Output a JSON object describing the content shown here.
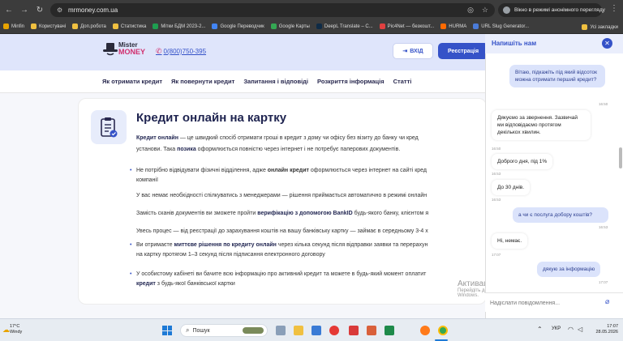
{
  "browser": {
    "url": "mrmoney.com.ua",
    "incognito_label": "Вікно в режимі анонімного перегляду",
    "bookmarks": [
      {
        "label": "Minfin",
        "color": "#e8a400"
      },
      {
        "label": "Користувачі",
        "color": "#f0c040"
      },
      {
        "label": "Доп.робота",
        "color": "#f0c040"
      },
      {
        "label": "Статистика",
        "color": "#f0c040"
      },
      {
        "label": "Мітки БДМ 2023-2...",
        "color": "#1e9e50"
      },
      {
        "label": "Google Переводчик",
        "color": "#4285f4"
      },
      {
        "label": "Google Карты",
        "color": "#34a853"
      },
      {
        "label": "DeepL Translate – С...",
        "color": "#0f2b46"
      },
      {
        "label": "Pic4Net — безкошт...",
        "color": "#e04040"
      },
      {
        "label": "HURMA",
        "color": "#ff6a00"
      },
      {
        "label": "URL Slug Generator...",
        "color": "#4a7bd8"
      }
    ],
    "all_bookmarks": "Усі закладки"
  },
  "site": {
    "logo_top": "Mister",
    "logo_bottom": "MONEY",
    "phone": "0(800)750-395",
    "login": "ВХІД",
    "register": "Реєстрація",
    "nav": [
      "Як отримати кредит",
      "Як повернути кредит",
      "Запитання і відповіді",
      "Розкриття інформація",
      "Статті"
    ]
  },
  "article": {
    "title": "Кредит онлайн на картку",
    "intro_bold": "Кредит онлайн",
    "intro_text": " — це швидкий спосіб отримати гроші в кредит з дому чи офісу без візиту до банку чи кред",
    "intro_line2_a": "установи. Така ",
    "intro_line2_bold": "позика",
    "intro_line2_b": " оформлюється повністю через інтернет і не потребує паперових документів.",
    "bullets": [
      {
        "a": "Не потрібно відвідувати фізичні відділення, адже ",
        "b": "онлайн кредит",
        "c": " оформлюється через інтернет на сайті кред",
        "d": "компанії"
      },
      {
        "a": "У вас немає необхідності спілкуватись з менеджерами — рішення приймається автоматично в режимі онлайн",
        "b": "",
        "c": "",
        "d": ""
      },
      {
        "a": "Замість сканів документів ви зможете пройти ",
        "b": "верифікацію з допомогою BankID",
        "c": " будь-якого банку, клієнтом я",
        "d": ""
      },
      {
        "a": "Увесь процес — від реєстрації до зарахування коштів на вашу банківську картку — займає в середньому 3-4 х",
        "b": "",
        "c": "",
        "d": ""
      },
      {
        "a": "Ви отримаєте ",
        "b": "миттєве рішення по кредиту онлайн",
        "c": " через кілька секунд після відправки заявки та перерахун",
        "d": "на картку протягом 1–3 секунд після підписання електронного договору"
      },
      {
        "a": "У особистому кабінеті ви бачите всю інформацію про активний кредит та можете в будь-який момент оплатит",
        "b": "",
        "c": "",
        "d": "",
        "e_bold": "кредит",
        "e": " з будь-якої банківської картки"
      }
    ]
  },
  "chat": {
    "title": "Напишіть нам",
    "messages": [
      {
        "from": "me",
        "text": "Вітаю, підкажіть під який відсоток можна отримати перший кредит?",
        "time": "16:50"
      },
      {
        "from": "them",
        "text": "Дякуємо за звернення. Зазвичай ми відповідаємо протягом декількох хвилин.",
        "time": "16:50"
      },
      {
        "from": "them",
        "text": "Доброго дня, під 1%",
        "time": "16:53"
      },
      {
        "from": "them",
        "text": "До 30 днів.",
        "time": "16:53"
      },
      {
        "from": "me",
        "text": "а чи є послуга добору коштів?",
        "time": "16:53"
      },
      {
        "from": "them",
        "text": "Ні, немає.",
        "time": "17:07"
      },
      {
        "from": "me",
        "text": "дякую за інформацію",
        "time": "17:07"
      }
    ],
    "placeholder": "Надіслати повідомлення..."
  },
  "watermark": {
    "title": "Активація Windows",
    "line1": "Перейдіть до розділу \"Настройки\", щоб активувати",
    "line2": "Windows."
  },
  "taskbar": {
    "weather_temp": "17°C",
    "weather_label": "Windy",
    "search_label": "Пошук",
    "lang": "УКР",
    "time": "17:07",
    "date": "28.05.2026"
  }
}
